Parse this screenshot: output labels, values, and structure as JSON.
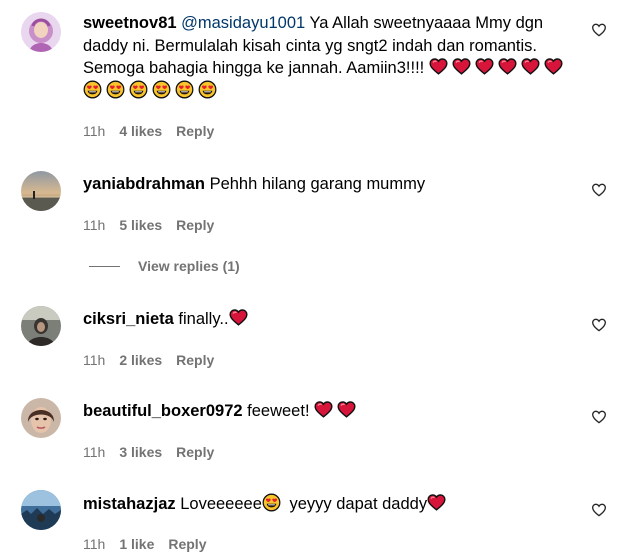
{
  "comments": [
    {
      "username": "sweetnov81",
      "mention": "@masidayu1001",
      "text": "Ya Allah sweetnyaaaa Mmy dgn daddy ni. Bermulalah kisah cinta yg sngt2 indah dan romantis. Semoga bahagia hingga ke jannah. Aamiin3!!!!",
      "time": "11h",
      "likes": "4 likes",
      "reply": "Reply"
    },
    {
      "username": "yaniabdrahman",
      "text": "Pehhh hilang garang mummy",
      "time": "11h",
      "likes": "5 likes",
      "reply": "Reply",
      "view_replies": "View replies (1)"
    },
    {
      "username": "ciksri_nieta",
      "text": "finally..",
      "time": "11h",
      "likes": "2 likes",
      "reply": "Reply"
    },
    {
      "username": "beautiful_boxer0972",
      "text": "feeweet!",
      "time": "11h",
      "likes": "3 likes",
      "reply": "Reply"
    },
    {
      "username": "mistahazjaz",
      "text_a": "Loveeeeee",
      "text_b": "yeyyy dapat daddy",
      "time": "11h",
      "likes": "1 like",
      "reply": "Reply"
    }
  ],
  "colors": {
    "meta": "#737373",
    "mention": "#00376b",
    "heart": "#e0245e"
  },
  "icons": {
    "like": "heart-outline-icon",
    "heart_emoji": "red-heart-emoji",
    "eyes_emoji": "heart-eyes-emoji"
  }
}
